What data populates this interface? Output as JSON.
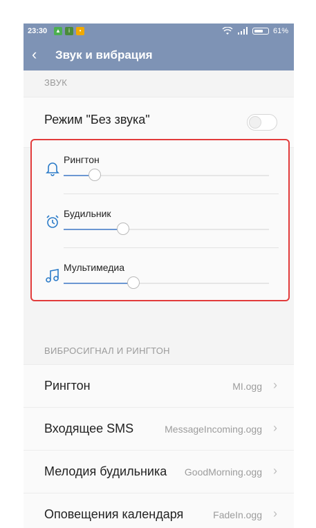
{
  "status_bar": {
    "time": "23:30",
    "battery_percent": "61%"
  },
  "app_bar": {
    "title": "Звук и вибрация"
  },
  "sections": {
    "sound": "ЗВУК",
    "vibration": "ВИБРОСИГНАЛ И РИНГТОН"
  },
  "silent_mode": {
    "label": "Режим \"Без звука\"",
    "enabled": false
  },
  "volumes": [
    {
      "label": "Рингтон",
      "icon": "bell-icon",
      "level": 0.15
    },
    {
      "label": "Будильник",
      "icon": "alarm-clock-icon",
      "level": 0.29
    },
    {
      "label": "Мультимедиа",
      "icon": "music-note-icon",
      "level": 0.34
    }
  ],
  "settings": [
    {
      "label": "Рингтон",
      "value": "MI.ogg"
    },
    {
      "label": "Входящее SMS",
      "value": "MessageIncoming.ogg"
    },
    {
      "label": "Мелодия будильника",
      "value": "GoodMorning.ogg"
    },
    {
      "label": "Оповещения календаря",
      "value": "FadeIn.ogg"
    }
  ],
  "colors": {
    "accent": "#6b97d2",
    "header": "#7e93b5",
    "highlight_border": "#e23b3b"
  }
}
